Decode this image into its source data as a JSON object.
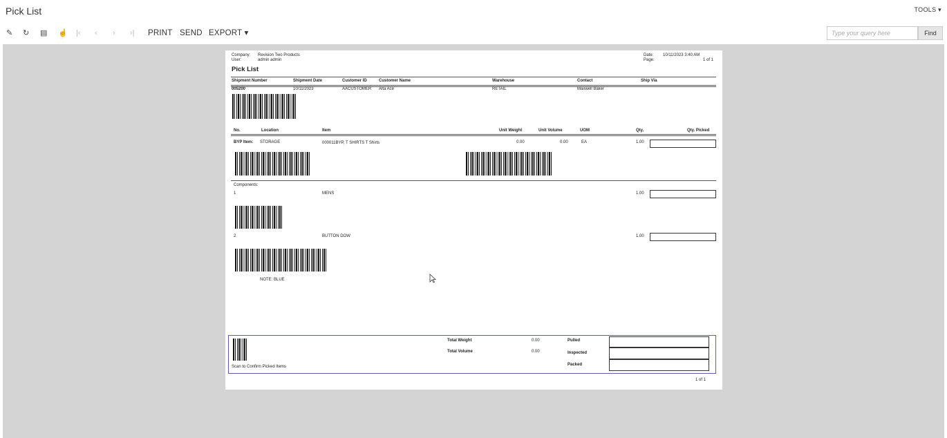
{
  "header": {
    "title": "Pick List",
    "tools_label": "TOOLS ▾"
  },
  "toolbar": {
    "print": "PRINT",
    "send": "SEND",
    "export": "EXPORT ▾",
    "search_placeholder": "Type your query here",
    "find": "Find"
  },
  "report": {
    "company_label": "Company:",
    "company": "Revision Two Products",
    "user_label": "User:",
    "user": "admin admin",
    "date_label": "Date:",
    "date": "10/11/2023 3:40 AM",
    "page_label": "Page:",
    "page": "1 of 1",
    "title": "Pick List",
    "ship_headers": [
      "Shipment Number",
      "Shipment Date",
      "Customer ID",
      "Customer Name",
      "Warehouse",
      "Contact",
      "Ship Via"
    ],
    "ship_row": [
      "005200",
      "10/11/2023",
      "AACUSTOMER",
      "Alta Ace",
      "RETAIL",
      "Maxwell Baker",
      ""
    ],
    "line_headers": [
      "No.",
      "Location",
      "Item",
      "Unit Weight",
      "Unit Volume",
      "UOM",
      "Qty.",
      "Qty. Picked"
    ],
    "line": {
      "no": "BYP Item:",
      "location": "STORAGE",
      "item": "000011BYP, T SHIRTS T Shirts",
      "weight": "0.00",
      "volume": "0.00",
      "uom": "EA",
      "qty": "1.00"
    },
    "components_label": "Components:",
    "components": [
      {
        "no": "1",
        "item": "MENS",
        "qty": "1.00"
      },
      {
        "no": "2",
        "item": "BUTTON DOW",
        "qty": "1.00"
      }
    ],
    "note": "NOTE:  BLUE",
    "footer": {
      "scan_label": "Scan to Confirm Picked Items",
      "total_weight_label": "Total Weight",
      "total_weight": "0.00",
      "total_volume_label": "Total Volume",
      "total_volume": "0.00",
      "pulled": "Pulled",
      "inspected": "Inspected",
      "packed": "Packed"
    },
    "page_footer": "1 of 1"
  }
}
